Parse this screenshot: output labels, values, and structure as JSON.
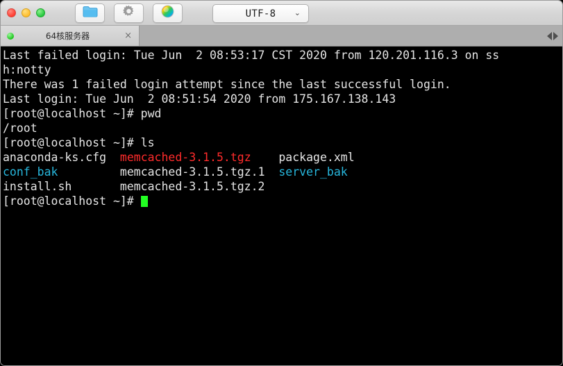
{
  "window": {
    "traffic_lights": [
      {
        "name": "close",
        "color": "#ff3b30"
      },
      {
        "name": "minimize",
        "color": "#ffbd2e"
      },
      {
        "name": "zoom",
        "color": "#28c840"
      }
    ],
    "toolbar": [
      {
        "name": "folder-icon",
        "label": "folder"
      },
      {
        "name": "gear-icon",
        "label": "settings"
      },
      {
        "name": "color-wheel-icon",
        "label": "colors"
      }
    ],
    "encoding": {
      "value": "UTF-8",
      "caret": "⌄"
    }
  },
  "tabs": {
    "items": [
      {
        "title": "64核服务器",
        "status_dot": "#18c318",
        "close": "×"
      }
    ],
    "nav": {
      "prev": "◀",
      "next": "▶"
    }
  },
  "terminal": {
    "colors": {
      "background": "#000000",
      "foreground": "#e6e6e6",
      "archive": "#ff2b2b",
      "directory": "#27b7dd",
      "cursor": "#22ff22"
    },
    "lines": [
      {
        "id": "line-1",
        "segments": [
          {
            "text": "Last failed login: Tue Jun  2 08:53:17 CST 2020 from 120.201.116.3 on ss",
            "color": "foreground"
          }
        ]
      },
      {
        "id": "line-2",
        "segments": [
          {
            "text": "h:notty",
            "color": "foreground"
          }
        ]
      },
      {
        "id": "line-3",
        "segments": [
          {
            "text": "There was 1 failed login attempt since the last successful login.",
            "color": "foreground"
          }
        ]
      },
      {
        "id": "line-4",
        "segments": [
          {
            "text": "Last login: Tue Jun  2 08:51:54 2020 from 175.167.138.143",
            "color": "foreground"
          }
        ]
      },
      {
        "id": "line-5",
        "segments": [
          {
            "text": "[root@localhost ~]# pwd",
            "color": "foreground"
          }
        ]
      },
      {
        "id": "line-6",
        "segments": [
          {
            "text": "/root",
            "color": "foreground"
          }
        ]
      },
      {
        "id": "line-7",
        "segments": [
          {
            "text": "[root@localhost ~]# ls",
            "color": "foreground"
          }
        ]
      },
      {
        "id": "line-8",
        "segments": [
          {
            "text": "anaconda-ks.cfg  ",
            "color": "foreground"
          },
          {
            "text": "memcached-3.1.5.tgz",
            "color": "archive"
          },
          {
            "text": "    package.xml",
            "color": "foreground"
          }
        ]
      },
      {
        "id": "line-9",
        "segments": [
          {
            "text": "conf_bak",
            "color": "directory"
          },
          {
            "text": "         memcached-3.1.5.tgz.1  ",
            "color": "foreground"
          },
          {
            "text": "server_bak",
            "color": "directory"
          }
        ]
      },
      {
        "id": "line-10",
        "segments": [
          {
            "text": "install.sh       memcached-3.1.5.tgz.2",
            "color": "foreground"
          }
        ]
      },
      {
        "id": "line-11",
        "segments": [
          {
            "text": "[root@localhost ~]# ",
            "color": "foreground"
          },
          {
            "text": "",
            "color": "cursor",
            "cursor": true
          }
        ]
      }
    ]
  }
}
